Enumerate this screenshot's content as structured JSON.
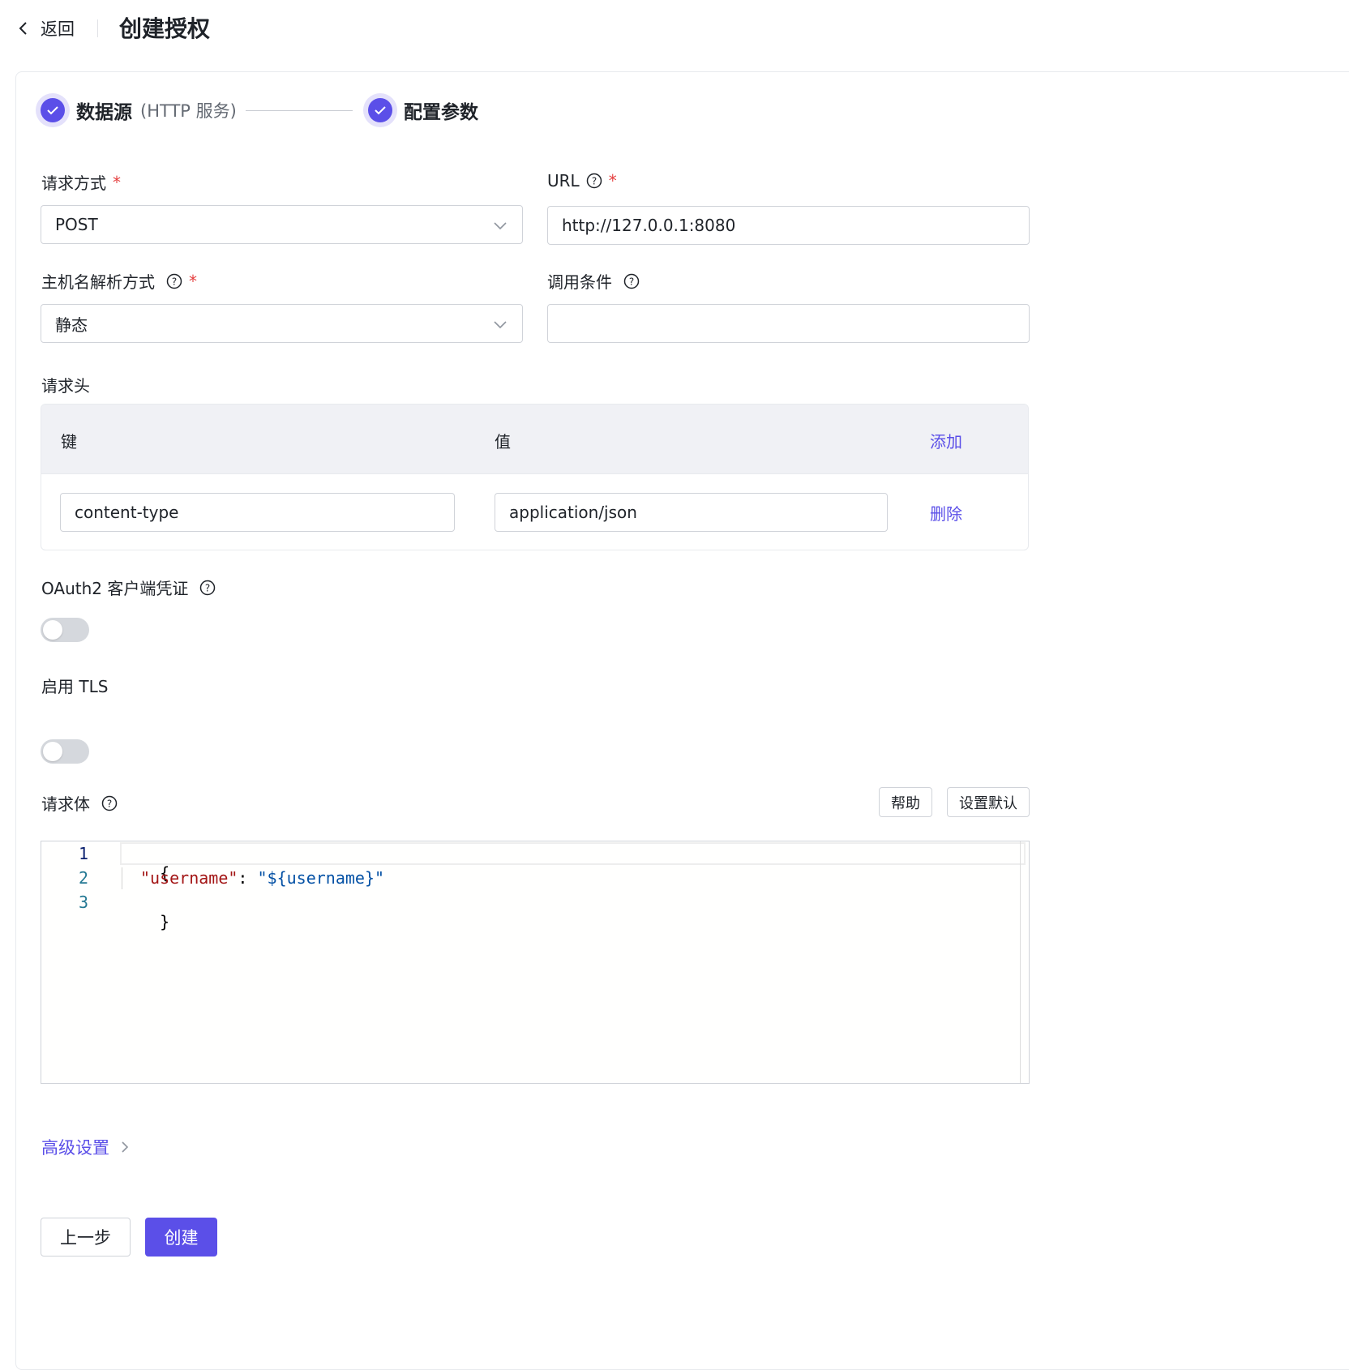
{
  "header": {
    "back_label": "返回",
    "title": "创建授权"
  },
  "steps": [
    {
      "title": "数据源",
      "subtitle": "(HTTP 服务)",
      "status": "done"
    },
    {
      "title": "配置参数",
      "subtitle": "",
      "status": "done"
    }
  ],
  "form": {
    "method": {
      "label": "请求方式",
      "value": "POST"
    },
    "url": {
      "label": "URL",
      "value": "http://127.0.0.1:8080"
    },
    "host_resolution": {
      "label": "主机名解析方式",
      "value": "静态"
    },
    "call_condition": {
      "label": "调用条件",
      "value": ""
    },
    "headers": {
      "label": "请求头",
      "col_key": "键",
      "col_value": "值",
      "add_label": "添加",
      "rows": [
        {
          "key": "content-type",
          "value": "application/json",
          "delete_label": "删除"
        }
      ]
    },
    "oauth2": {
      "label": "OAuth2 客户端凭证",
      "enabled": false
    },
    "tls": {
      "label": "启用 TLS",
      "enabled": false
    },
    "body": {
      "label": "请求体",
      "help_button": "帮助",
      "default_button": "设置默认",
      "lines": {
        "l1": {
          "num": "1",
          "open": "{"
        },
        "l2": {
          "num": "2",
          "key": "\"username\"",
          "colon": ": ",
          "value": "\"${username}\""
        },
        "l3": {
          "num": "3",
          "close": "}"
        }
      }
    },
    "advanced_label": "高级设置"
  },
  "footer": {
    "prev_label": "上一步",
    "create_label": "创建"
  },
  "colors": {
    "primary": "#5b4fe8",
    "required": "#e53f3f",
    "table_header_bg": "#f0f1f5"
  }
}
